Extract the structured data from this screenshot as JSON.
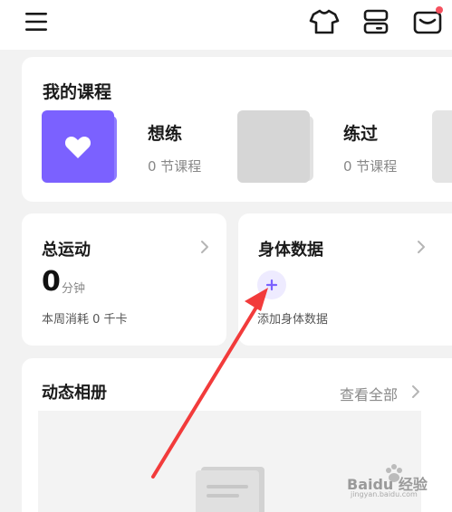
{
  "header": {
    "menu_icon": "menu-icon",
    "icons": [
      "shirt-icon",
      "device-icon",
      "mail-icon"
    ],
    "has_notification": true,
    "accent_color": "#7b61ff",
    "notification_color": "#f5515f"
  },
  "courses": {
    "title": "我的课程",
    "items": [
      {
        "name": "想练",
        "count": "0 节课程",
        "cover_icon": "heart-icon"
      },
      {
        "name": "练过",
        "count": "0 节课程"
      }
    ]
  },
  "exercise": {
    "title": "总运动",
    "value": "0",
    "unit": "分钟",
    "subtitle": "本周消耗 0 千卡"
  },
  "body_data": {
    "title": "身体数据",
    "add_label": "添加身体数据"
  },
  "album": {
    "title": "动态相册",
    "view_all": "查看全部"
  },
  "watermark": {
    "text": "Baidu 经验",
    "url": "jingyan.baidu.com"
  }
}
